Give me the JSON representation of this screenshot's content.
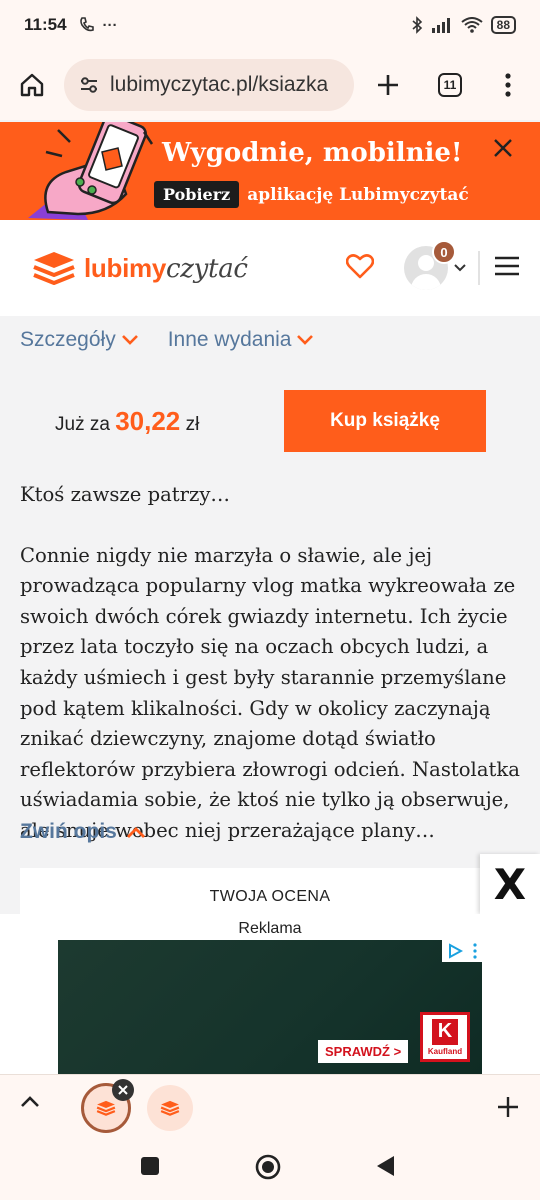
{
  "status": {
    "time": "11:54",
    "left_icons": [
      "call-icon",
      "more-icon"
    ],
    "battery": "88"
  },
  "browser": {
    "url": "lubimyczytac.pl/ksiazka",
    "tab_count": "11"
  },
  "promo": {
    "title": "Wygodnie, mobilnie!",
    "button": "Pobierz",
    "subtitle": "aplikację Lubimyczytać"
  },
  "header": {
    "logo_bold": "lubimy",
    "logo_italic": "czytać",
    "notifications": "0"
  },
  "sub_nav": {
    "details": "Szczegóły",
    "editions": "Inne wydania"
  },
  "buy": {
    "prefix": "Już za",
    "price": "30,22",
    "currency": "zł",
    "button": "Kup książkę"
  },
  "description": {
    "teaser": "Ktoś zawsze patrzy…",
    "body": "Connie nigdy nie marzyła o sławie, ale jej prowadząca popularny vlog matka wykreowała ze swoich dwóch córek gwiazdy internetu. Ich życie przez lata toczyło się na oczach obcych ludzi, a każdy uśmiech i gest były starannie przemyślane pod kątem klikalności. Gdy w okolicy zaczynają znikać dziewczyny, znajome dotąd światło reflektorów przybiera złowrogi odcień. Nastolatka uświadamia sobie, że ktoś nie tylko ją obserwuje, ale snuje wobec niej przerażające plany…",
    "collapse": "Zwiń opis"
  },
  "rating": {
    "title": "TWOJA OCENA"
  },
  "ad": {
    "label": "Reklama",
    "cta": "SPRAWDŹ >",
    "brand": "Kaufland",
    "close": "X"
  },
  "colors": {
    "accent": "#ff5d1b",
    "link": "#56779c",
    "badge": "#a65a3a"
  }
}
